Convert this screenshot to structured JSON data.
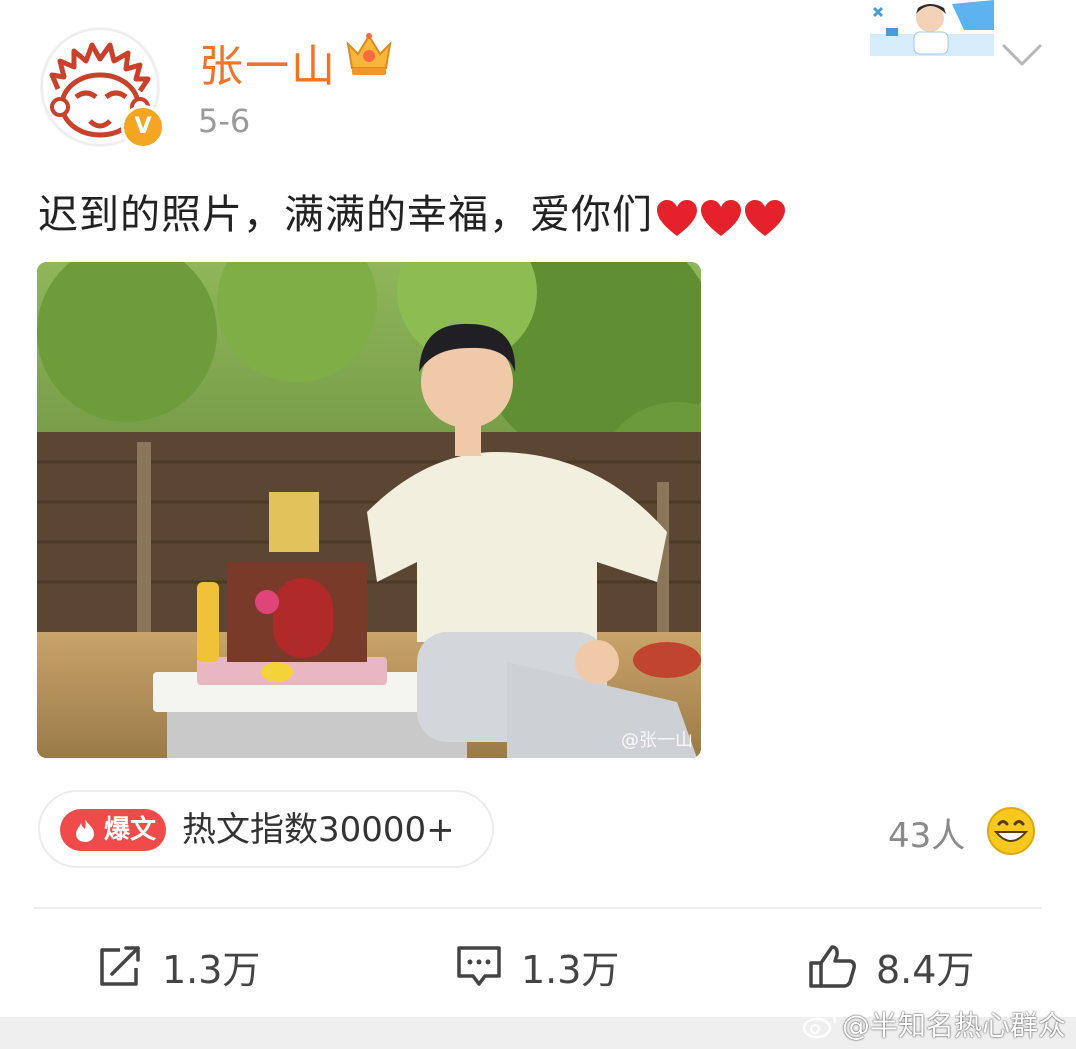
{
  "header": {
    "username": "张一山",
    "date": "5-6",
    "verified": "V",
    "username_color": "#f07428"
  },
  "post": {
    "text": "迟到的照片，满满的幸福，爱你们",
    "hearts": [
      "heart-icon",
      "heart-icon",
      "heart-icon"
    ],
    "photo_watermark": "@张一山"
  },
  "hot": {
    "tag_label": "爆文",
    "index_text": "热文指数30000+",
    "tag_color": "#f04b4b"
  },
  "reactions": {
    "count_text": "43人",
    "emoji": "grinning-face-icon"
  },
  "actions": {
    "repost": "1.3万",
    "comment": "1.3万",
    "like": "8.4万"
  },
  "source_watermark": "@半知名热心群众"
}
